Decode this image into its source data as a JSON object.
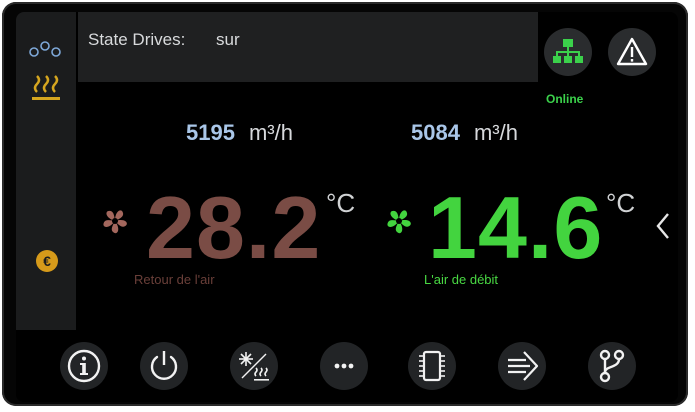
{
  "status": {
    "label": "State Drives:",
    "value": "sur",
    "connection": "Online"
  },
  "sensors": {
    "return_air": {
      "flow_value": "5195",
      "flow_unit": "m³/h",
      "temperature": "28.2",
      "unit": "°C",
      "label": "Retour de l'air",
      "color": "#a3675d"
    },
    "supply_air": {
      "flow_value": "5084",
      "flow_unit": "m³/h",
      "temperature": "14.6",
      "unit": "°C",
      "label": "L'air de débit",
      "color": "#43d43f"
    }
  },
  "sidebar": {
    "icons": [
      "fan-group-icon",
      "heating-icon",
      "euro-icon"
    ]
  },
  "toolbar": {
    "buttons": [
      "info-icon",
      "power-icon",
      "frost-heat-icon",
      "more-icon",
      "chip-icon",
      "export-arrow-icon",
      "branch-icon"
    ]
  },
  "colors": {
    "accent_green": "#3bd14b",
    "accent_yellow": "#d6a61f"
  }
}
